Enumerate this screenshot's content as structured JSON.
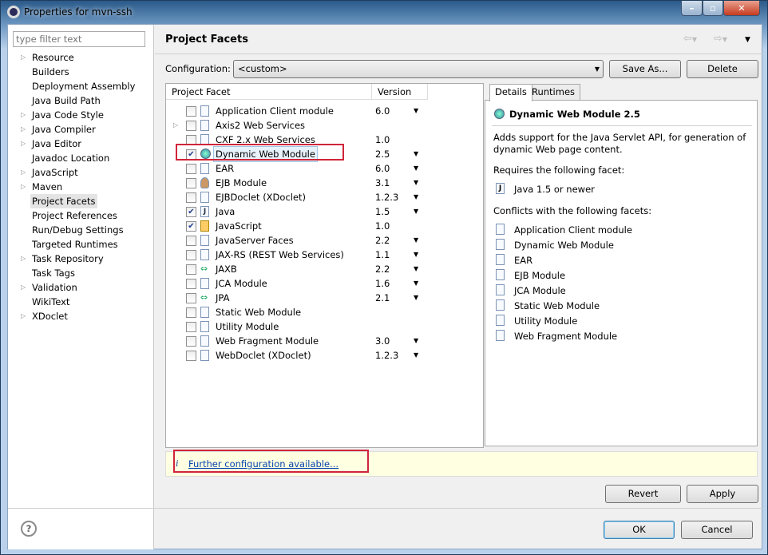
{
  "window": {
    "title": "Properties for mvn-ssh",
    "controls": [
      "minimize",
      "maximize",
      "close"
    ]
  },
  "sidebar": {
    "filter_placeholder": "type filter text",
    "items": [
      {
        "label": "Resource",
        "expandable": true
      },
      {
        "label": "Builders",
        "expandable": false
      },
      {
        "label": "Deployment Assembly",
        "expandable": false
      },
      {
        "label": "Java Build Path",
        "expandable": false
      },
      {
        "label": "Java Code Style",
        "expandable": true
      },
      {
        "label": "Java Compiler",
        "expandable": true
      },
      {
        "label": "Java Editor",
        "expandable": true
      },
      {
        "label": "Javadoc Location",
        "expandable": false
      },
      {
        "label": "JavaScript",
        "expandable": true
      },
      {
        "label": "Maven",
        "expandable": true
      },
      {
        "label": "Project Facets",
        "expandable": false,
        "selected": true
      },
      {
        "label": "Project References",
        "expandable": false
      },
      {
        "label": "Run/Debug Settings",
        "expandable": false
      },
      {
        "label": "Targeted Runtimes",
        "expandable": false
      },
      {
        "label": "Task Repository",
        "expandable": true
      },
      {
        "label": "Task Tags",
        "expandable": false
      },
      {
        "label": "Validation",
        "expandable": true
      },
      {
        "label": "WikiText",
        "expandable": false
      },
      {
        "label": "XDoclet",
        "expandable": true
      }
    ]
  },
  "page": {
    "title": "Project Facets",
    "config_label": "Configuration:",
    "config_value": "<custom>",
    "save_as": "Save As...",
    "delete": "Delete"
  },
  "facets": {
    "col_facet": "Project Facet",
    "col_version": "Version",
    "rows": [
      {
        "name": "Application Client module",
        "version": "6.0",
        "checked": false,
        "dropdown": true,
        "icon": "page"
      },
      {
        "name": "Axis2 Web Services",
        "version": "",
        "checked": false,
        "dropdown": false,
        "icon": "page",
        "expandable": true
      },
      {
        "name": "CXF 2.x Web Services",
        "version": "1.0",
        "checked": false,
        "dropdown": false,
        "icon": "page"
      },
      {
        "name": "Dynamic Web Module",
        "version": "2.5",
        "checked": true,
        "dropdown": true,
        "icon": "globe",
        "selected": true
      },
      {
        "name": "EAR",
        "version": "6.0",
        "checked": false,
        "dropdown": true,
        "icon": "page"
      },
      {
        "name": "EJB Module",
        "version": "3.1",
        "checked": false,
        "dropdown": true,
        "icon": "bean"
      },
      {
        "name": "EJBDoclet (XDoclet)",
        "version": "1.2.3",
        "checked": false,
        "dropdown": true,
        "icon": "page"
      },
      {
        "name": "Java",
        "version": "1.5",
        "checked": true,
        "dropdown": true,
        "icon": "java"
      },
      {
        "name": "JavaScript",
        "version": "1.0",
        "checked": true,
        "dropdown": false,
        "icon": "lock"
      },
      {
        "name": "JavaServer Faces",
        "version": "2.2",
        "checked": false,
        "dropdown": true,
        "icon": "page"
      },
      {
        "name": "JAX-RS (REST Web Services)",
        "version": "1.1",
        "checked": false,
        "dropdown": true,
        "icon": "page"
      },
      {
        "name": "JAXB",
        "version": "2.2",
        "checked": false,
        "dropdown": true,
        "icon": "arrows"
      },
      {
        "name": "JCA Module",
        "version": "1.6",
        "checked": false,
        "dropdown": true,
        "icon": "page"
      },
      {
        "name": "JPA",
        "version": "2.1",
        "checked": false,
        "dropdown": true,
        "icon": "arrows"
      },
      {
        "name": "Static Web Module",
        "version": "",
        "checked": false,
        "dropdown": false,
        "icon": "page"
      },
      {
        "name": "Utility Module",
        "version": "",
        "checked": false,
        "dropdown": false,
        "icon": "page"
      },
      {
        "name": "Web Fragment Module",
        "version": "3.0",
        "checked": false,
        "dropdown": true,
        "icon": "page"
      },
      {
        "name": "WebDoclet (XDoclet)",
        "version": "1.2.3",
        "checked": false,
        "dropdown": true,
        "icon": "page"
      }
    ]
  },
  "details": {
    "tabs": [
      "Details",
      "Runtimes"
    ],
    "title": "Dynamic Web Module 2.5",
    "desc1": "Adds support for the Java Servlet API, for generation of",
    "desc2": "dynamic Web page content.",
    "requires_label": "Requires the following facet:",
    "requires": [
      "Java 1.5 or newer"
    ],
    "conflicts_label": "Conflicts with the following facets:",
    "conflicts": [
      "Application Client module",
      "Dynamic Web Module",
      "EAR",
      "EJB Module",
      "JCA Module",
      "Static Web Module",
      "Utility Module",
      "Web Fragment Module"
    ]
  },
  "info": {
    "icon": "info-icon",
    "link": "Further configuration available..."
  },
  "buttons": {
    "revert": "Revert",
    "apply": "Apply",
    "ok": "OK",
    "cancel": "Cancel"
  },
  "colors": {
    "highlight": "#d0253a",
    "info_bg": "#ffffe1"
  }
}
